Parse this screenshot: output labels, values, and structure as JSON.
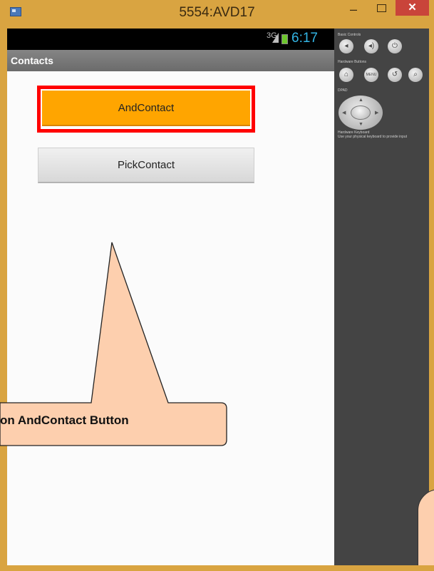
{
  "window": {
    "title": "5554:AVD17",
    "minimize_glyph": "–",
    "close_glyph": "✕"
  },
  "status_bar": {
    "network": "3G",
    "time": "6:17"
  },
  "app": {
    "title": "Contacts",
    "buttons": {
      "and_contact": "AndContact",
      "pick_contact": "PickContact"
    }
  },
  "callout": {
    "text": "on AndContact Button"
  },
  "emulator_panel": {
    "basic_controls_label": "Basic Controls",
    "hardware_buttons_label": "Hardware Buttons",
    "dpad_label": "DPAD",
    "keyboard_label": "Hardware Keyboard",
    "keyboard_hint": "Use your physical keyboard to provide input",
    "menu_label": "MENU",
    "icons": [
      "volume-down-icon",
      "volume-up-icon",
      "power-icon",
      "home-icon",
      "menu-icon",
      "back-icon",
      "search-icon"
    ]
  },
  "colors": {
    "window_frame": "#d9a441",
    "highlight_border": "#ff0000",
    "and_contact_bg": "#ffa500",
    "callout_fill": "#fdcfae",
    "clock": "#33b5e5"
  }
}
